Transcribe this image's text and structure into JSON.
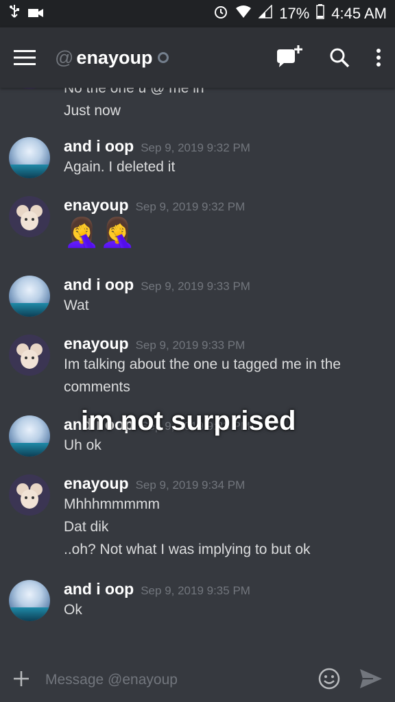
{
  "status_bar": {
    "battery": "17%",
    "time": "4:45 AM"
  },
  "header": {
    "at_symbol": "@",
    "channel_name": "enayoup"
  },
  "messages": {
    "partial_top_line": "No the one u @ me in",
    "partial_time": "Just now",
    "m1": {
      "author": "and i oop",
      "time": "Sep 9, 2019 9:32 PM",
      "lines": [
        "Again. I deleted it"
      ]
    },
    "m2": {
      "author": "enayoup",
      "time": "Sep 9, 2019 9:32 PM",
      "emoji": "🤦‍♀️🤦‍♀️"
    },
    "m3": {
      "author": "and i oop",
      "time": "Sep 9, 2019 9:33 PM",
      "lines": [
        "Wat"
      ]
    },
    "m4": {
      "author": "enayoup",
      "time": "Sep 9, 2019 9:33 PM",
      "lines": [
        "Im talking about the one u tagged me in the comments"
      ]
    },
    "m5": {
      "author": "and i oop",
      "time": "Sep 9, 2019 9:33 PM",
      "lines": [
        "Uh ok"
      ]
    },
    "m6": {
      "author": "enayoup",
      "time": "Sep 9, 2019 9:34 PM",
      "lines": [
        "Mhhhmmmmm",
        "Dat dik",
        "..oh? Not what I was implying to but ok"
      ]
    },
    "m7": {
      "author": "and i oop",
      "time": "Sep 9, 2019 9:35 PM",
      "lines": [
        "Ok"
      ]
    }
  },
  "overlay_caption": "im not surprised",
  "composer": {
    "placeholder": "Message @enayoup"
  },
  "colors": {
    "background": "#36393f",
    "header": "#2f3136",
    "status_bar": "#202225",
    "timestamp": "#72767d"
  },
  "icons": [
    "usb-icon",
    "video-icon",
    "alarm-icon",
    "wifi-icon",
    "signal-icon",
    "battery-icon",
    "menu-icon",
    "new-message-icon",
    "search-icon",
    "more-icon",
    "plus-icon",
    "emoji-icon",
    "send-icon"
  ]
}
